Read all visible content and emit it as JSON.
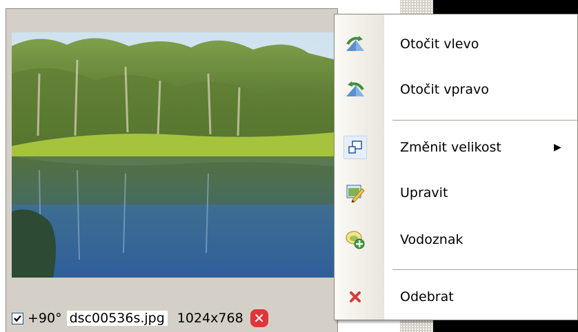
{
  "thumbnail": {
    "rotation": "+90°",
    "filename": "dsc00536s.jpg",
    "dimensions": "1024x768",
    "checked": true
  },
  "context_menu": {
    "items": [
      {
        "label": "Otočit vlevo",
        "icon": "rotate-left-icon"
      },
      {
        "label": "Otočit vpravo",
        "icon": "rotate-right-icon"
      },
      {
        "label": "Změnit velikost",
        "icon": "resize-icon",
        "submenu": true
      },
      {
        "label": "Upravit",
        "icon": "edit-icon"
      },
      {
        "label": "Vodoznak",
        "icon": "watermark-icon"
      },
      {
        "label": "Odebrat",
        "icon": "remove-icon"
      }
    ],
    "submenu_arrow": "▶"
  },
  "colors": {
    "remove_red": "#e3343a",
    "panel_gray": "#d4d0c8"
  }
}
